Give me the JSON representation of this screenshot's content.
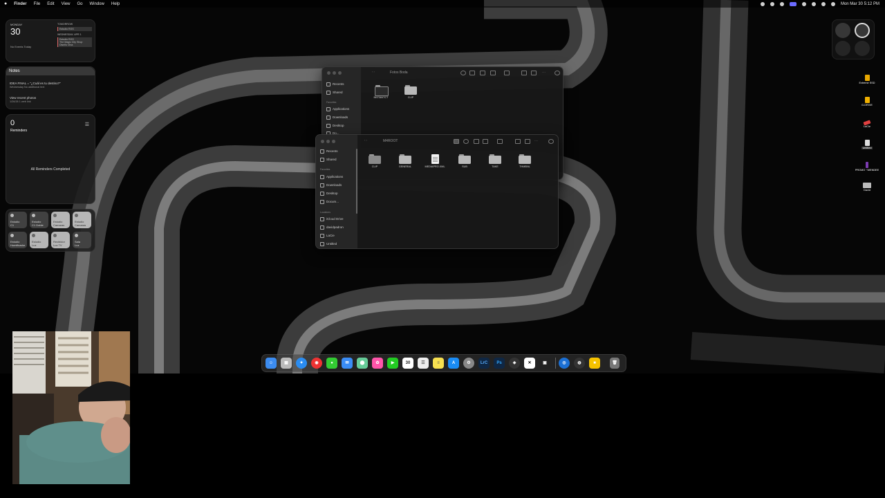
{
  "menubar": {
    "apple": "",
    "app": "Finder",
    "items": [
      "File",
      "Edit",
      "View",
      "Go",
      "Window",
      "Help"
    ],
    "clock": "Mon Mar 30  5:12 PM"
  },
  "calendar_widget": {
    "weekday": "MONDAY",
    "date": "30",
    "no_events": "No Events Today",
    "tomorrow": "TOMORROW",
    "events": [
      "Estudio RGS",
      "WEDNESDAY, APR 1",
      "Estudio RGS",
      "The Magic City Shop",
      "Diseño Vina"
    ]
  },
  "notes_widget": {
    "title": "Notes",
    "note1_title": "IDEA FINAL = \"¿Cuál es tu destino?\"",
    "note1_sub": "Wednesday  No additional text",
    "note2_title": "View recent photos",
    "note2_sub": "1/26/26  1 web link"
  },
  "reminders_widget": {
    "count": "0",
    "label": "Reminders",
    "done": "All Reminders Completed"
  },
  "home_widget": {
    "tiles": [
      [
        "Estudio",
        "C1"
      ],
      [
        "Estudio",
        "C1 Doble"
      ],
      [
        "Estudio",
        "Camaras"
      ],
      [
        "Estudio",
        "Camaras"
      ],
      [
        "Estudio",
        "Humificador"
      ],
      [
        "Estudio",
        "Luz"
      ],
      [
        "Recibidor",
        "Luz TV"
      ],
      [
        "Sala",
        "Luz"
      ]
    ]
  },
  "finder_back": {
    "title": "Fotos Boda",
    "sidebar": [
      "Recents",
      "Shared",
      "Favorites",
      "Applications",
      "Downloads",
      "Desktop",
      "Do..."
    ],
    "items": [
      "INSTANTCT",
      "CLIP"
    ]
  },
  "finder_front": {
    "title": "M4ROOT",
    "sidebar_top": [
      "Recents",
      "Shared"
    ],
    "favorites_head": "Favorites",
    "favorites": [
      "Applications",
      "Downloads",
      "Desktop",
      "Docum..."
    ],
    "locations_head": "Locations",
    "locations": [
      "iCloud Drive",
      "davidpadron",
      "LaCie",
      "Untitled"
    ],
    "items": [
      "CLIP",
      "GENERAL",
      "MEDIAPRO.XML",
      "SUB",
      "TAKE",
      "THMBNL"
    ]
  },
  "desktop_icons": [
    "Extreme SSD",
    "G-DRIVE",
    "LaCie",
    "Untitled",
    "PROMO ~WENDEE",
    "David"
  ],
  "dock": {
    "calendar_day": "30",
    "items": [
      "Finder",
      "Launchpad",
      "Safari",
      "Chrome",
      "Messages",
      "Mail",
      "Maps",
      "Photos",
      "FaceTime",
      "Calendar",
      "Reminders",
      "Notes",
      "App Store",
      "System Settings",
      "Lightroom Classic",
      "Photoshop",
      "DaVinci Resolve",
      "CapCut",
      "Final Cut",
      "Sep",
      "Proton VPN",
      "Activity",
      "Stickies",
      "Trash"
    ],
    "labels": {
      "lrc": "LrC",
      "ps": "Ps"
    }
  },
  "colors": {
    "accent": "#6b6bff",
    "finder_bg": "#181818",
    "folder": "#b9b9b9"
  }
}
